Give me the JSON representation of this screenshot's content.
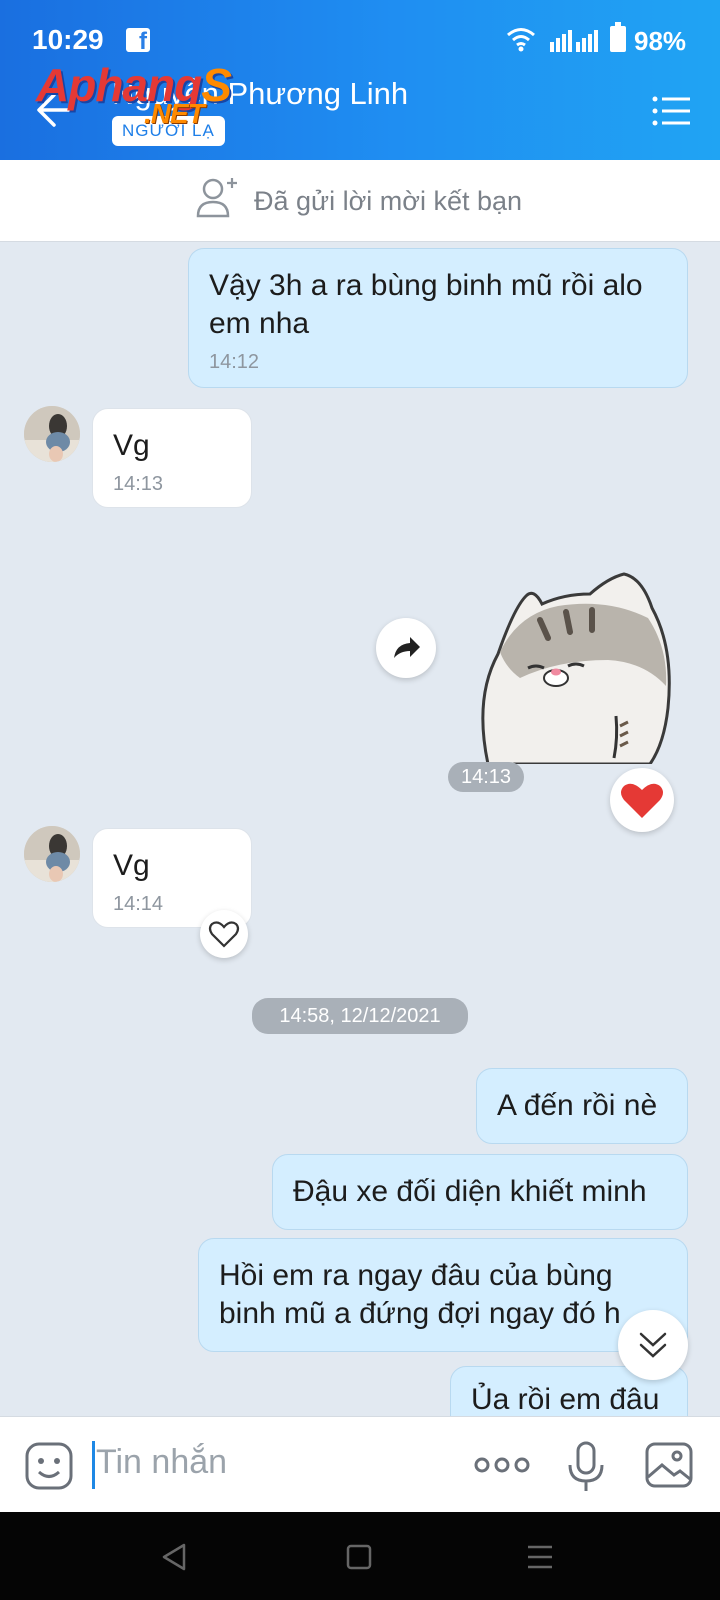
{
  "status_bar": {
    "time": "10:29",
    "battery": "98%",
    "app_icon": "facebook-icon"
  },
  "header": {
    "title": "Nguyễn Phương Linh",
    "badge": "NGƯỜI LẠ",
    "watermark_main": "Aphang",
    "watermark_s": "S",
    "watermark_sub": ".NET"
  },
  "friend_request": {
    "text": "Đã gửi lời mời kết bạn"
  },
  "messages": [
    {
      "side": "me",
      "text": "Vậy 3h a ra bùng binh mũ rồi alo em nha",
      "time": "14:12"
    },
    {
      "side": "them",
      "text": "Vg",
      "time": "14:13"
    },
    {
      "side": "me",
      "type": "sticker",
      "time": "14:13",
      "reaction": "heart"
    },
    {
      "side": "them",
      "text": "Vg",
      "time": "14:14"
    },
    {
      "side": "me",
      "text": "A đến rồi nè"
    },
    {
      "side": "me",
      "text": "Đậu xe đối diện khiết minh"
    },
    {
      "side": "me",
      "text": "Hồi em ra ngay đâu của bùng binh mũ a đứng đợi ngay đó h"
    },
    {
      "side": "me",
      "text": "Ủa rồi em đâu"
    }
  ],
  "date_separator": "14:58, 12/12/2021",
  "input": {
    "placeholder": "Tin nhắn"
  },
  "colors": {
    "header_start": "#1a6fe0",
    "header_end": "#20a4f3",
    "my_bubble": "#d4eeff",
    "chat_bg": "#e2e9f1",
    "heart": "#e53935"
  }
}
